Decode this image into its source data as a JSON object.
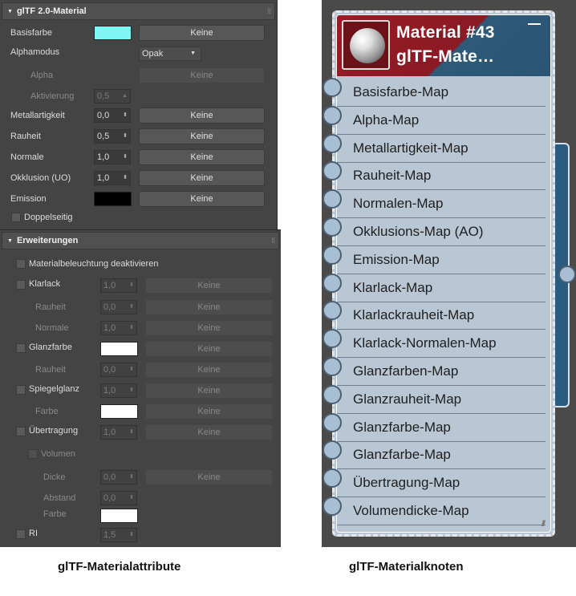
{
  "panel1": {
    "title": "glTF 2.0-Material",
    "basisfarbe": {
      "label": "Basisfarbe",
      "color": "#7ff7f5",
      "map": "Keine"
    },
    "alphamodus": {
      "label": "Alphamodus",
      "value": "Opak"
    },
    "alpha": {
      "label": "Alpha",
      "map": "Keine"
    },
    "aktivierung": {
      "label": "Aktivierung",
      "value": "0,5"
    },
    "metall": {
      "label": "Metallartigkeit",
      "value": "0,0",
      "map": "Keine"
    },
    "rauheit": {
      "label": "Rauheit",
      "value": "0,5",
      "map": "Keine"
    },
    "normale": {
      "label": "Normale",
      "value": "1,0",
      "map": "Keine"
    },
    "okklusion": {
      "label": "Okklusion (UO)",
      "value": "1,0",
      "map": "Keine"
    },
    "emission": {
      "label": "Emission",
      "color": "#000000",
      "map": "Keine"
    },
    "doppelseitig": {
      "label": "Doppelseitig"
    }
  },
  "panel2": {
    "title": "Erweiterungen",
    "beleuchtung": {
      "label": "Materialbeleuchtung deaktivieren"
    },
    "klarlack": {
      "label": "Klarlack",
      "value": "1,0",
      "map": "Keine"
    },
    "klarlack_rauheit": {
      "label": "Rauheit",
      "value": "0,0",
      "map": "Keine"
    },
    "klarlack_normale": {
      "label": "Normale",
      "value": "1,0",
      "map": "Keine"
    },
    "glanzfarbe": {
      "label": "Glanzfarbe",
      "color": "#ffffff",
      "map": "Keine"
    },
    "glanz_rauheit": {
      "label": "Rauheit",
      "value": "0,0",
      "map": "Keine"
    },
    "spiegelglanz": {
      "label": "Spiegelglanz",
      "value": "1,0",
      "map": "Keine"
    },
    "spiegel_farbe": {
      "label": "Farbe",
      "color": "#ffffff",
      "map": "Keine"
    },
    "uebertragung": {
      "label": "Übertragung",
      "value": "1,0",
      "map": "Keine"
    },
    "volumen": {
      "label": "Volumen"
    },
    "dicke": {
      "label": "Dicke",
      "value": "0,0",
      "map": "Keine"
    },
    "abstand": {
      "label": "Abstand",
      "value": "0,0"
    },
    "vol_farbe": {
      "label": "Farbe",
      "color": "#ffffff"
    },
    "ri": {
      "label": "RI",
      "value": "1,5"
    }
  },
  "node": {
    "title_line1": "Material #43",
    "title_line2": "glTF-Mate…",
    "slots": [
      "Basisfarbe-Map",
      "Alpha-Map",
      "Metallartigkeit-Map",
      "Rauheit-Map",
      "Normalen-Map",
      "Okklusions-Map (AO)",
      "Emission-Map",
      "Klarlack-Map",
      "Klarlackrauheit-Map",
      "Klarlack-Normalen-Map",
      "Glanzfarben-Map",
      "Glanzrauheit-Map",
      "Glanzfarbe-Map",
      "Glanzfarbe-Map",
      "Übertragung-Map",
      "Volumendicke-Map"
    ]
  },
  "captions": {
    "left": "glTF-Materialattribute",
    "right": "glTF-Materialknoten"
  }
}
